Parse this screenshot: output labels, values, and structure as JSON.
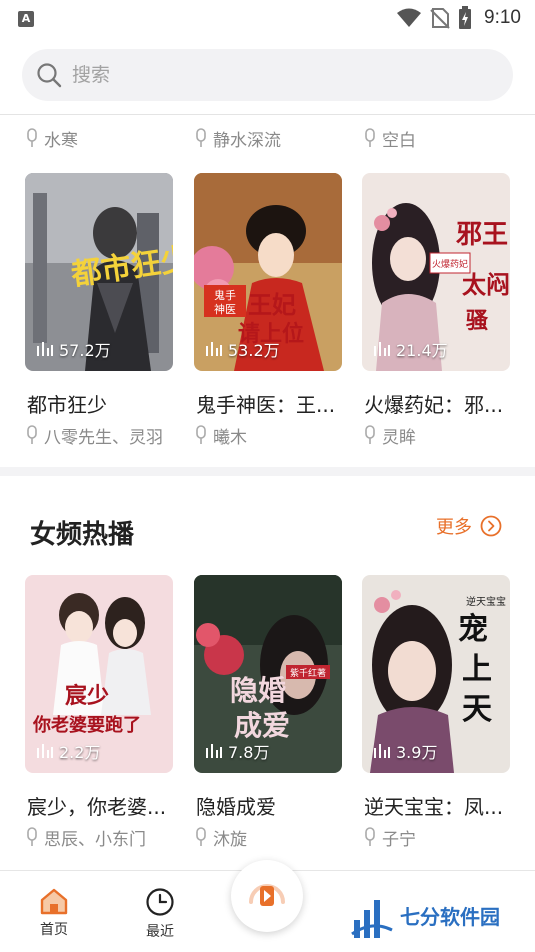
{
  "status_bar": {
    "app_icon": "A",
    "time": "9:10",
    "icons": [
      "wifi-icon",
      "no-sim-icon",
      "battery-charging-icon"
    ]
  },
  "search": {
    "placeholder": "搜索",
    "icon": "search-icon"
  },
  "top_narrators": [
    "水寒",
    "静水深流",
    "空白"
  ],
  "row1": [
    {
      "title": "都市狂少",
      "plays": "57.2万",
      "narrator": "八零先生、灵羽",
      "cover_text": "都市狂少"
    },
    {
      "title": "鬼手神医：王...",
      "plays": "53.2万",
      "narrator": "曦木",
      "cover_text": "王妃请上位"
    },
    {
      "title": "火爆药妃：邪...",
      "plays": "21.4万",
      "narrator": "灵眸",
      "cover_text": "邪王太闷骚"
    }
  ],
  "section": {
    "title": "女频热播",
    "more_label": "更多"
  },
  "row2": [
    {
      "title": "宸少，你老婆...",
      "plays": "2.2万",
      "narrator": "思辰、小东门",
      "cover_text": "宸少你老婆要跑了"
    },
    {
      "title": "隐婚成爱",
      "plays": "7.8万",
      "narrator": "沐旋",
      "cover_text": "隐婚成爱"
    },
    {
      "title": "逆天宝宝：凤...",
      "plays": "3.9万",
      "narrator": "子宁",
      "cover_text": "宠上天"
    }
  ],
  "bottom_nav": {
    "home_label": "首页",
    "recent_label": "最近",
    "active_color": "#e8702a"
  },
  "watermark": "七分软件园",
  "colors": {
    "accent": "#e8702a",
    "muted": "#8a8a8a",
    "search_bg": "#f2f2f4"
  }
}
